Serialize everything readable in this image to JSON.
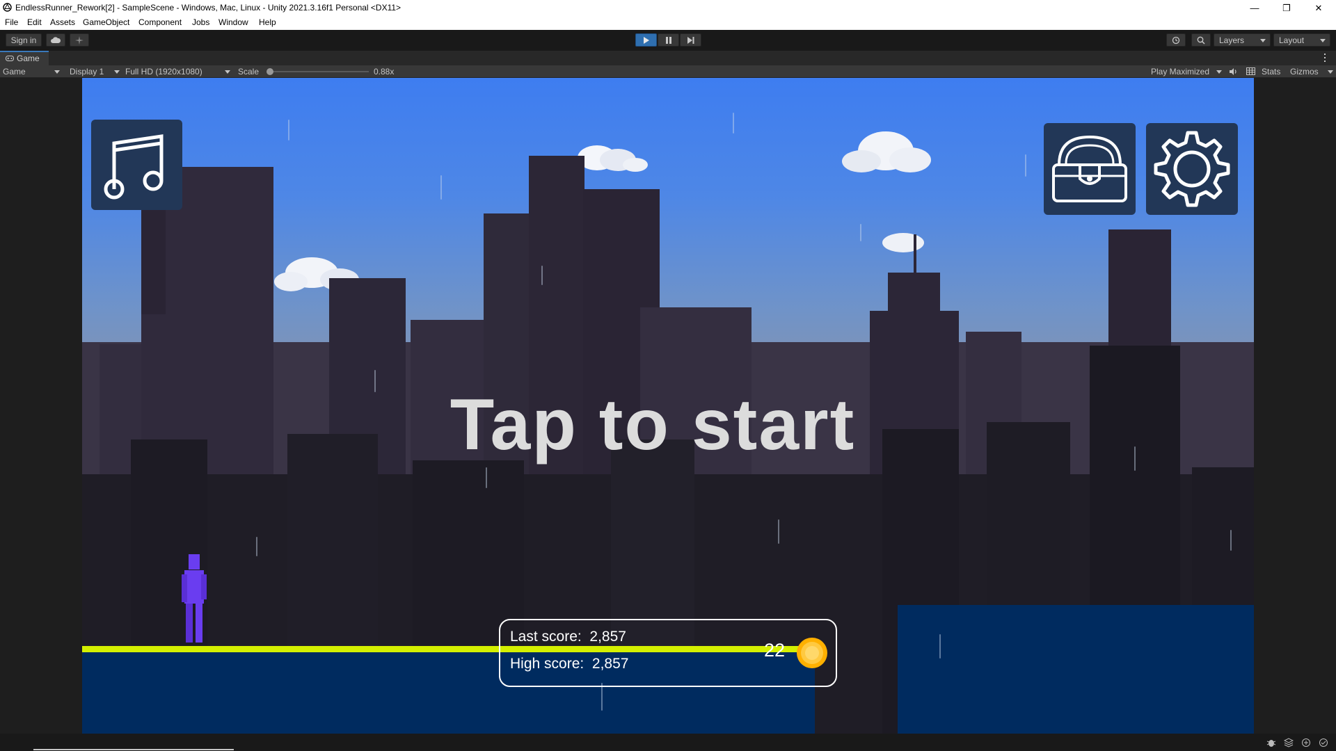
{
  "window": {
    "title": "EndlessRunner_Rework[2] - SampleScene - Windows, Mac, Linux - Unity 2021.3.16f1 Personal <DX11>",
    "controls": {
      "minimize": "—",
      "restore": "❐",
      "close": "✕"
    }
  },
  "menu": [
    "File",
    "Edit",
    "Assets",
    "GameObject",
    "Component",
    "Jobs",
    "Window",
    "Help"
  ],
  "toolbar": {
    "sign_in": "Sign in",
    "layers": "Layers",
    "layout": "Layout"
  },
  "game_tab": {
    "label": "Game"
  },
  "game_bar": {
    "mode": "Game",
    "display": "Display 1",
    "resolution": "Full HD (1920x1080)",
    "scale_label": "Scale",
    "scale_value": "0.88x",
    "play_mode": "Play Maximized",
    "stats": "Stats",
    "gizmos": "Gizmos"
  },
  "scene": {
    "prompt": "Tap to start",
    "coins": "22",
    "last_score_label": "Last score:",
    "last_score_value": "2,857",
    "high_score_label": "High score:",
    "high_score_value": "2,857"
  },
  "colors": {
    "accent_play": "#2f6fb0",
    "ground_line": "#d4f000",
    "water": "#002b5f",
    "ui_button": "#223757",
    "player": "#6a3df0"
  },
  "icons": [
    "music-icon",
    "chest-icon",
    "settings-gear-icon",
    "coin-icon"
  ]
}
